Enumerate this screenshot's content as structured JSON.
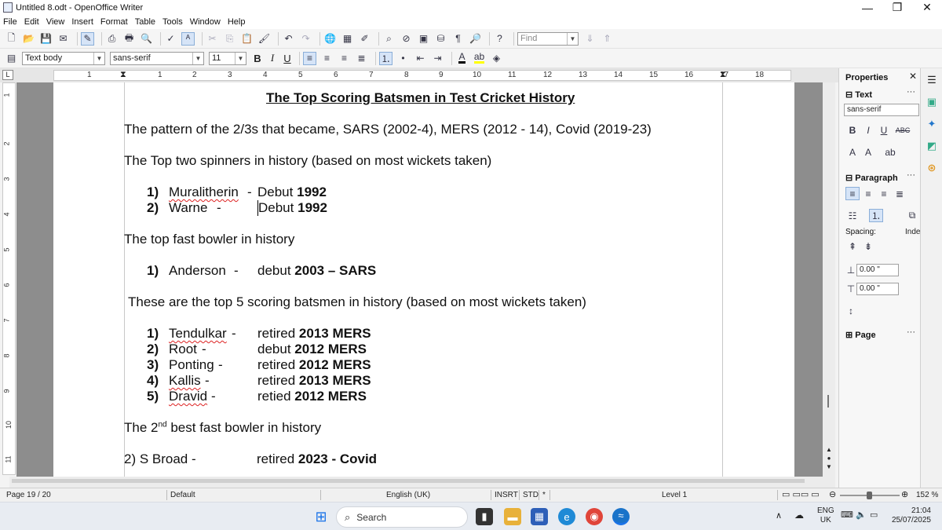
{
  "window": {
    "title": "Untitled 8.odt - OpenOffice Writer",
    "minimize": "—",
    "maximize": "❐",
    "close": "✕"
  },
  "menu": [
    "File",
    "Edit",
    "View",
    "Insert",
    "Format",
    "Table",
    "Tools",
    "Window",
    "Help"
  ],
  "toolbar": {
    "find_placeholder": "Find",
    "para_style": "Text body",
    "font_name": "sans-serif",
    "font_size": "11",
    "bold": "B",
    "italic": "I",
    "underline": "U"
  },
  "ruler": {
    "numbers": [
      "1",
      "1",
      "2",
      "3",
      "4",
      "5",
      "6",
      "7",
      "8",
      "9",
      "10",
      "11",
      "12",
      "13",
      "14",
      "15",
      "16",
      "17",
      "18"
    ],
    "vnumbers": [
      "1",
      "2",
      "3",
      "4",
      "5",
      "6",
      "7",
      "8",
      "9",
      "10",
      "11"
    ]
  },
  "document": {
    "title": "The Top Scoring Batsmen in Test Cricket History",
    "line1": "The pattern of the 2/3s that became, SARS (2002-4), MERS (2012 - 14), Covid (2019-23)",
    "line2": "The Top two spinners in history (based on most wickets taken)",
    "spinners": [
      {
        "n": "1)",
        "name": "Muralitherin",
        "dash": "-",
        "desc": "Debut",
        "bold": "1992"
      },
      {
        "n": "2)",
        "name": "Warne",
        "dash": "-",
        "desc": "Debut",
        "bold": "1992"
      }
    ],
    "line3": "The top fast bowler in history",
    "bowler": {
      "n": "1)",
      "name": "Anderson",
      "dash": "-",
      "desc": "debut",
      "bold": "2003 – SARS"
    },
    "line4": "These are the top 5 scoring batsmen in history (based on most wickets taken)",
    "batsmen": [
      {
        "n": "1)",
        "name": "Tendulkar",
        "dash": "-",
        "desc": "retired",
        "bold": "2013 MERS"
      },
      {
        "n": "2)",
        "name": "Root",
        "dash": "-",
        "desc": "debut",
        "bold": "2012 MERS"
      },
      {
        "n": "3)",
        "name": "Ponting",
        "dash": "-",
        "desc": "retired",
        "bold": "2012 MERS"
      },
      {
        "n": "4)",
        "name": "Kallis",
        "dash": "-",
        "desc": "retired",
        "bold": "2013 MERS"
      },
      {
        "n": "5)",
        "name": "Dravid",
        "dash": "-",
        "desc": "retied",
        "bold": "2012 MERS"
      }
    ],
    "line5_pre": "The 2",
    "line5_sup": "nd",
    "line5_post": " best fast bowler in history",
    "broad": {
      "pre": "2) S Broad -",
      "desc": "retired",
      "bold": "2023 - Covid"
    }
  },
  "sidebar": {
    "title": "Properties",
    "text_section": "Text",
    "font": "sans-serif",
    "paragraph_section": "Paragraph",
    "spacing_label": "Spacing:",
    "indent_label": "Inde",
    "above": "0.00 \"",
    "below": "0.00 \"",
    "page_section": "Page"
  },
  "status": {
    "page": "Page 19 / 20",
    "style": "Default",
    "language": "English (UK)",
    "insert": "INSRT",
    "select": "STD",
    "modified": "*",
    "level": "Level 1",
    "zoom": "152 %"
  },
  "taskbar": {
    "search": "Search",
    "lang1": "ENG",
    "lang2": "UK",
    "time": "21:04",
    "date": "25/07/2025"
  }
}
